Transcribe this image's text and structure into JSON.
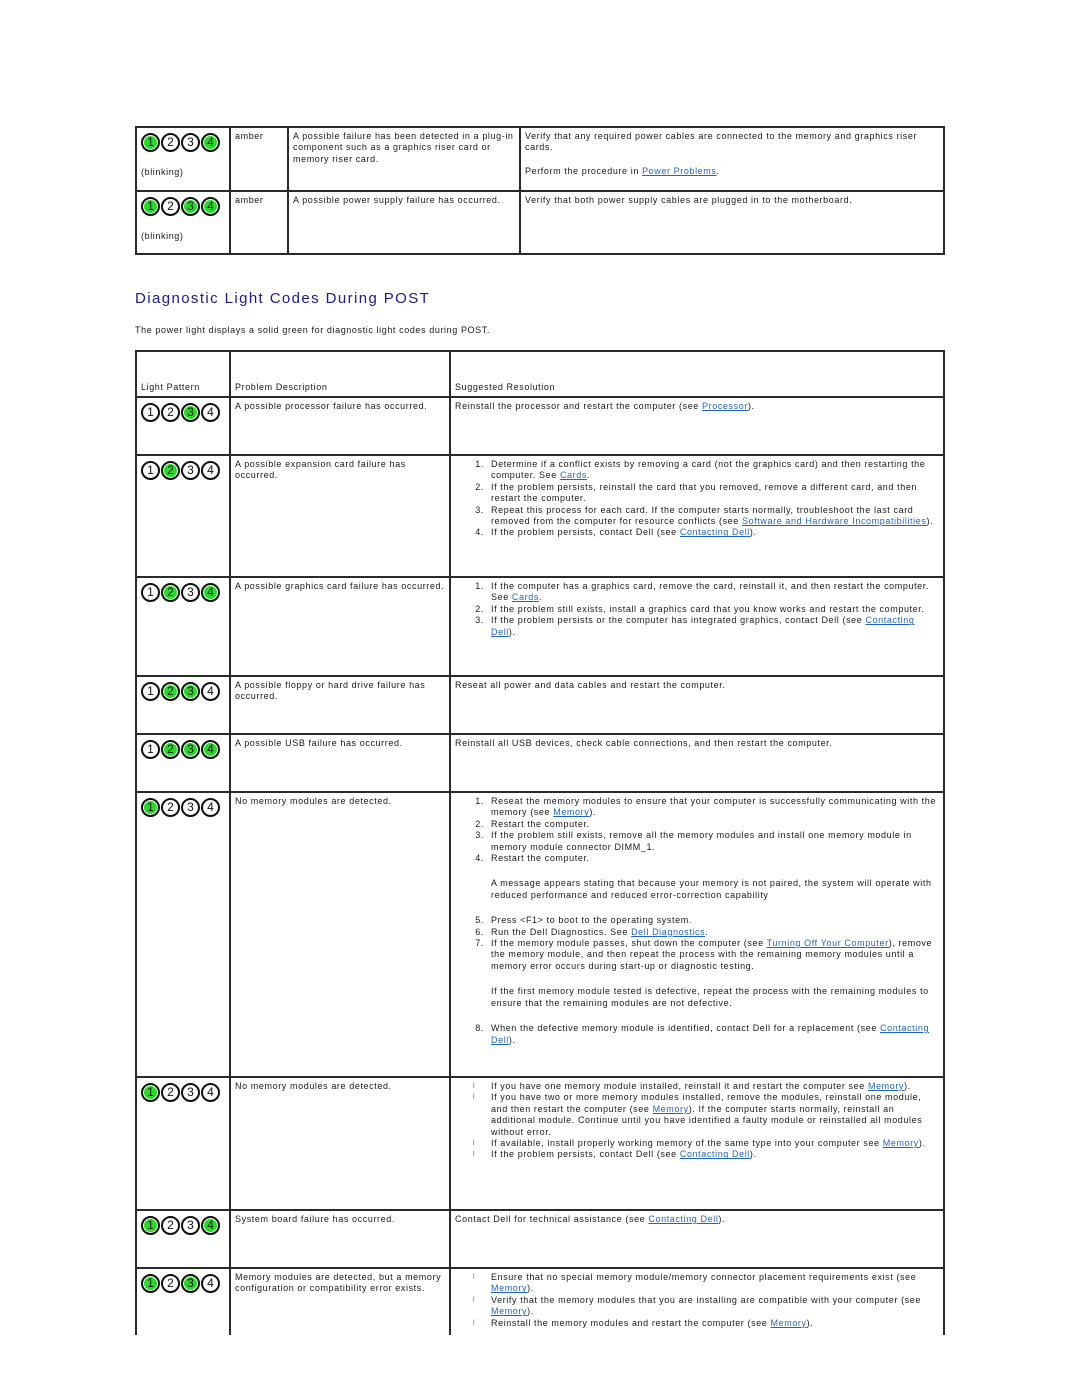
{
  "top_table": {
    "rows": [
      {
        "lights": [
          true,
          false,
          false,
          true
        ],
        "pattern_note": "(blinking)",
        "color": "amber",
        "problem": "A possible failure has been detected in a plug-in component such as a graphics riser card or memory riser card.",
        "resolution_1": "Verify that any required power cables are connected to the memory and graphics riser cards.",
        "resolution_2_prefix": "Perform the procedure in ",
        "resolution_2_link": "Power Problems",
        "resolution_2_suffix": "."
      },
      {
        "lights": [
          true,
          false,
          true,
          true
        ],
        "pattern_note": "(blinking)",
        "color": "amber",
        "problem": "A possible power supply failure has occurred.",
        "resolution_1": "Verify that both power supply cables are plugged in to the motherboard."
      }
    ]
  },
  "section": {
    "title": "Diagnostic Light Codes During POST",
    "intro": "The power light displays a solid green for diagnostic light codes during POST."
  },
  "post_table": {
    "headers": [
      "Light Pattern",
      "Problem Description",
      "Suggested Resolution"
    ],
    "rows": [
      {
        "lights": [
          false,
          false,
          true,
          false
        ],
        "problem": "A possible processor failure has occurred.",
        "resolution": {
          "prefix": "Reinstall the processor and restart the computer (see ",
          "link": "Processor",
          "suffix": ")."
        }
      },
      {
        "lights": [
          false,
          true,
          false,
          false
        ],
        "problem": "A possible expansion card failure has occurred.",
        "steps": [
          {
            "text": " Determine if a conflict exists by removing a card (not the graphics card) and then restarting the computer. See ",
            "link": "Cards",
            "suffix": "."
          },
          {
            "text": " If the problem persists, reinstall the card that you removed, remove a different card, and then restart the computer."
          },
          {
            "text": " Repeat this process for each card. If the computer starts normally, troubleshoot the last card removed from the computer for resource conflicts (see ",
            "link": "Software and Hardware Incompatibilities",
            "suffix": ")."
          },
          {
            "text": " If the problem persists, contact Dell (see ",
            "link": "Contacting Dell",
            "suffix": ")."
          }
        ]
      },
      {
        "lights": [
          false,
          true,
          false,
          true
        ],
        "problem": "A possible graphics card failure has occurred.",
        "steps": [
          {
            "text": " If the computer has a graphics card, remove the card, reinstall it, and then restart the computer. See ",
            "link": "Cards",
            "suffix": "."
          },
          {
            "text": " If the problem still exists, install a graphics card that you know works and restart the computer."
          },
          {
            "text": " If the problem persists or the computer has integrated graphics, contact Dell (see ",
            "link": "Contacting Dell",
            "suffix": ")."
          }
        ]
      },
      {
        "lights": [
          false,
          true,
          true,
          false
        ],
        "problem": "A possible floppy or hard drive failure has occurred.",
        "resolution": {
          "prefix": "Reseat all power and data cables and restart the computer."
        }
      },
      {
        "lights": [
          false,
          true,
          true,
          true
        ],
        "problem": "A possible USB failure has occurred.",
        "resolution": {
          "prefix": "Reinstall all USB devices, check cable connections, and then restart the computer."
        }
      },
      {
        "lights": [
          true,
          false,
          false,
          false
        ],
        "problem": "No memory modules are detected.",
        "steps": [
          {
            "text": " Reseat the memory modules to ensure that your computer is successfully communicating with the memory (see ",
            "link": "Memory",
            "suffix": ")."
          },
          {
            "text": " Restart the computer."
          },
          {
            "text": " If the problem still exists, remove all the memory modules and install one memory module in memory module connector DIMM_1."
          },
          {
            "text": " Restart the computer.",
            "note": "A message appears stating that because your memory is not paired, the system will operate with reduced performance and reduced error-correction capability"
          },
          {
            "text": " Press <F1> to boot to the operating system."
          },
          {
            "text": " Run the Dell Diagnostics. See ",
            "link": "Dell Diagnostics",
            "suffix": "."
          },
          {
            "text": " If the memory module passes, shut down the computer (see ",
            "link": "Turning Off Your Computer",
            "suffix": "), remove the memory module, and then repeat the process with the remaining memory modules until a memory error occurs during start-up or diagnostic testing.",
            "note": "If the first memory module tested is defective, repeat the process with the remaining modules to ensure that the remaining modules are not defective."
          },
          {
            "text": " When the defective memory module is identified, contact Dell for a replacement (see ",
            "link": "Contacting Dell",
            "suffix": ")."
          }
        ]
      },
      {
        "lights": [
          true,
          false,
          false,
          false
        ],
        "problem": "No memory modules are detected.",
        "bullets": [
          {
            "text": " If you have one memory module installed, reinstall it and restart the computer see ",
            "link": "Memory",
            "suffix": ")."
          },
          {
            "text": " If you have two or more memory modules installed, remove the modules, reinstall one module, and then restart the computer (see ",
            "link": "Memory",
            "suffix": "). If the computer starts normally, reinstall an additional module. Continue until you have identified a faulty module or reinstalled all modules without error."
          },
          {
            "text": " If available, install properly working memory of the same type into your computer see ",
            "link": "Memory",
            "suffix": ")."
          },
          {
            "text": " If the problem persists, contact Dell (see ",
            "link": "Contacting Dell",
            "suffix": ")."
          }
        ]
      },
      {
        "lights": [
          true,
          false,
          false,
          true
        ],
        "problem": "System board failure has occurred.",
        "resolution": {
          "prefix": "Contact Dell for technical assistance (see ",
          "link": "Contacting Dell",
          "suffix": ")."
        }
      },
      {
        "lights": [
          true,
          false,
          true,
          false
        ],
        "problem": "Memory modules are detected, but a memory configuration or compatibility error exists.",
        "bullets": [
          {
            "text": " Ensure that no special memory module/memory connector placement requirements exist (see ",
            "link": "Memory",
            "suffix": ")."
          },
          {
            "text": " Verify that the memory modules that you are installing are compatible with your computer (see ",
            "link": "Memory",
            "suffix": ")."
          },
          {
            "text": " Reinstall the memory modules and restart the computer (see ",
            "link": "Memory",
            "suffix": ")."
          }
        ]
      }
    ]
  },
  "colors": {
    "light_on": "#22dd22",
    "heading": "#1a1a9a",
    "link": "#1f63c7"
  }
}
